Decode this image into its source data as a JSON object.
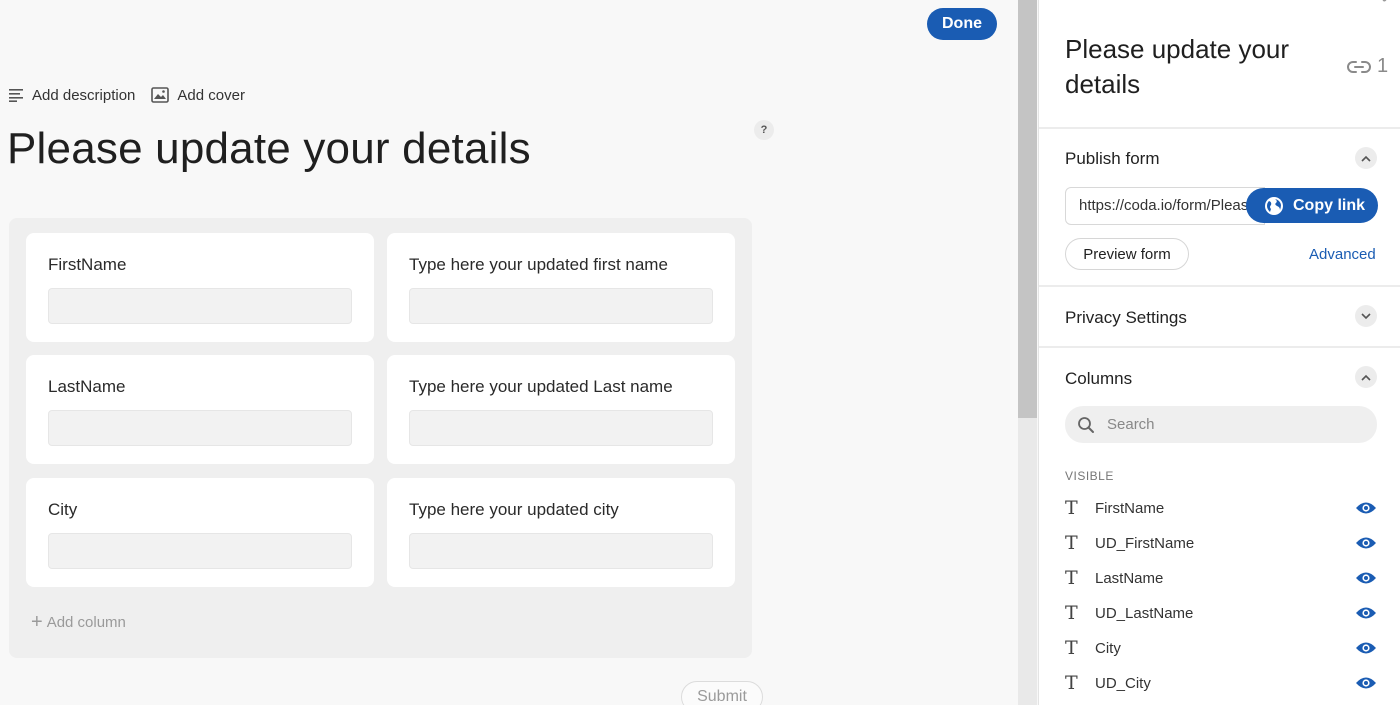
{
  "main": {
    "done_label": "Done",
    "add_description": "Add description",
    "add_cover": "Add cover",
    "help": "?",
    "title": "Please update your details",
    "fields": [
      {
        "label": "FirstName"
      },
      {
        "label": "Type here your updated first name"
      },
      {
        "label": "LastName"
      },
      {
        "label": "Type here your updated Last name"
      },
      {
        "label": "City"
      },
      {
        "label": "Type here your updated city"
      }
    ],
    "add_column": "Add column",
    "submit_label": "Submit"
  },
  "side": {
    "title": "Please update your details",
    "link_count": "1",
    "publish": {
      "heading": "Publish form",
      "url": "https://coda.io/form/Please-update-your-details",
      "copy_label": "Copy link",
      "preview_label": "Preview form",
      "advanced_label": "Advanced"
    },
    "privacy_heading": "Privacy Settings",
    "columns": {
      "heading": "Columns",
      "search_placeholder": "Search",
      "visible_label": "VISIBLE",
      "items": [
        {
          "name": "FirstName"
        },
        {
          "name": "UD_FirstName"
        },
        {
          "name": "LastName"
        },
        {
          "name": "UD_LastName"
        },
        {
          "name": "City"
        },
        {
          "name": "UD_City"
        }
      ]
    }
  },
  "colors": {
    "accent": "#1a5cb3",
    "panel_bg": "#efefef",
    "canvas_bg": "#f8f8f8"
  }
}
